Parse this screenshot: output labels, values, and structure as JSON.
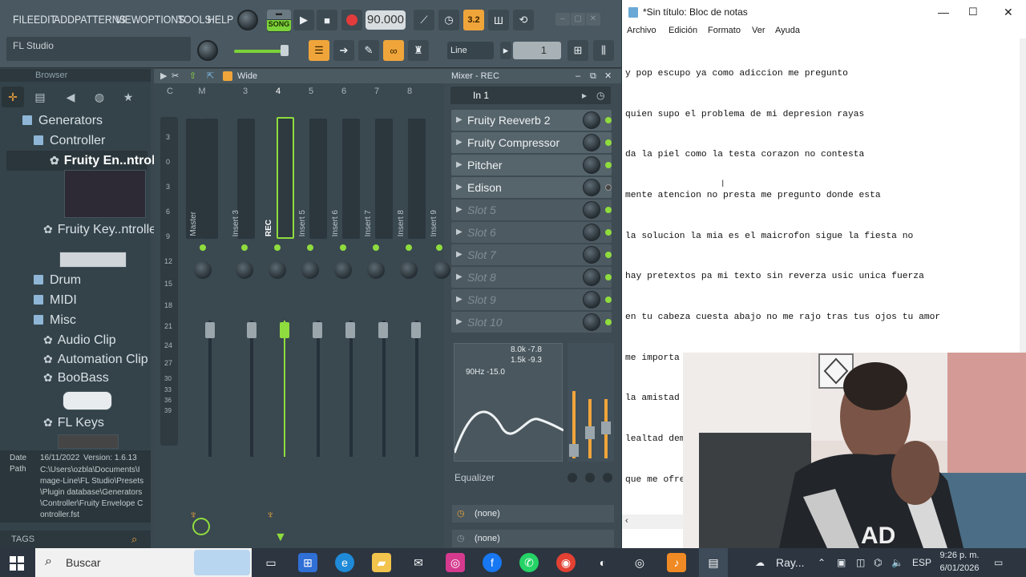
{
  "fl": {
    "menu": [
      "FILE",
      "EDIT",
      "ADD",
      "PATTERNS",
      "VIEW",
      "OPTIONS",
      "TOOLS",
      "HELP"
    ],
    "app_name": "FL Studio",
    "song_mode_label": "SONG",
    "tempo": "90.000",
    "time_sig_badge": "3.2",
    "snap_mode": "Line",
    "pattern_number": "1",
    "browser": {
      "title": "Browser",
      "tree": [
        {
          "label": "Generators",
          "kind": "folder"
        },
        {
          "label": "Controller",
          "kind": "folder"
        },
        {
          "label": "Fruity En..ntroller",
          "kind": "plugin"
        },
        {
          "label": "Fruity Key..ntroller",
          "kind": "plugin"
        },
        {
          "label": "Drum",
          "kind": "folder"
        },
        {
          "label": "MIDI",
          "kind": "folder"
        },
        {
          "label": "Misc",
          "kind": "folder"
        },
        {
          "label": "Audio Clip",
          "kind": "plugin"
        },
        {
          "label": "Automation Clip",
          "kind": "plugin"
        },
        {
          "label": "BooBass",
          "kind": "plugin"
        },
        {
          "label": "FL Keys",
          "kind": "plugin"
        }
      ],
      "info_date_label": "Date",
      "info_date": "16/11/2022",
      "info_version": "Version: 1.6.13",
      "info_path_label": "Path",
      "info_path": "C:\\Users\\ozbla\\Documents\\Image-Line\\FL Studio\\Presets\\Plugin database\\Generators\\Controller\\Fruity Envelope Controller.fst",
      "tags_label": "TAGS"
    },
    "mixer": {
      "view_mode": "Wide",
      "title": "Mixer - REC",
      "headers": [
        "C",
        "M",
        "3",
        "4",
        "5",
        "6",
        "7",
        "8"
      ],
      "tracks": [
        "Master",
        "Insert 3",
        "REC",
        "Insert 5",
        "Insert 6",
        "Insert 7",
        "Insert 8",
        "Insert 9"
      ],
      "db_scale": [
        "3",
        "0",
        "3",
        "6",
        "9",
        "12",
        "15",
        "18",
        "21",
        "24",
        "27",
        "30",
        "33",
        "36",
        "39"
      ],
      "input": "In 1",
      "slots": [
        {
          "label": "Fruity Reeverb 2",
          "empty": false
        },
        {
          "label": "Fruity Compressor",
          "empty": false
        },
        {
          "label": "Pitcher",
          "empty": false
        },
        {
          "label": "Edison",
          "empty": false
        },
        {
          "label": "Slot 5",
          "empty": true
        },
        {
          "label": "Slot 6",
          "empty": true
        },
        {
          "label": "Slot 7",
          "empty": true
        },
        {
          "label": "Slot 8",
          "empty": true
        },
        {
          "label": "Slot 9",
          "empty": true
        },
        {
          "label": "Slot 10",
          "empty": true
        }
      ],
      "eq_readout_1": "8.0k -7.8",
      "eq_readout_2": "1.5k -9.3",
      "eq_readout_3": "90Hz -15.0",
      "eq_label": "Equalizer",
      "send_1": "(none)",
      "send_2": "(none)"
    }
  },
  "notepad": {
    "title": "*Sin título: Bloc de notas",
    "menu": [
      "Archivo",
      "Edición",
      "Formato",
      "Ver",
      "Ayuda"
    ],
    "lines": [
      "y pop escupo ya como adiccion me pregunto",
      "quien supo el problema de mi depresion rayas",
      "da la piel como la testa corazon no contesta",
      "mente atencion no presta me pregunto donde esta",
      "la solucion la mia es el maicrofon sigue la fiesta no",
      "hay pretextos pa mi texto sin reverza usic unica fuerza",
      "en tu cabeza cuesta abajo no me rajo tras tus ojos tu amor",
      "me importa un carajo, sigue el geing mientras",
      "la amistad se resta a diestra y siniestra pocos",
      "lealtad demuestra yo vacio en cada track experiencias",
      "que me ofrezca "
    ]
  },
  "taskbar": {
    "search_placeholder": "Buscar",
    "weather_label": "Ray...",
    "language": "ESP",
    "time": "9:26 p. m.",
    "date": "6/01/2026"
  },
  "colors": {
    "fl_accent_green": "#8fdc3e",
    "fl_accent_orange": "#f0a53a",
    "fl_panel": "#3e4b52"
  }
}
